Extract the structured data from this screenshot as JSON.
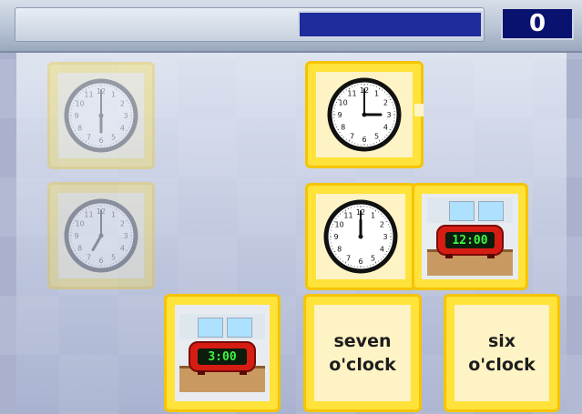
{
  "score": {
    "value": "0"
  },
  "progress": {
    "fraction": 1.0
  },
  "board": {
    "clock_cards": [
      {
        "id": "clock-3",
        "hour_hand_deg": 90,
        "minute_hand_deg": 0,
        "faded": false
      },
      {
        "id": "clock-12",
        "hour_hand_deg": 0,
        "minute_hand_deg": 0,
        "faded": false
      },
      {
        "id": "ghost-6",
        "hour_hand_deg": 180,
        "minute_hand_deg": 0,
        "faded": true
      },
      {
        "id": "ghost-7",
        "hour_hand_deg": 210,
        "minute_hand_deg": 0,
        "faded": true
      }
    ],
    "alarm_cards": [
      {
        "time": "12:00"
      },
      {
        "time": "3:00"
      }
    ],
    "word_cards": [
      {
        "text_line1": "seven",
        "text_line2": "o'clock"
      },
      {
        "text_line1": "six",
        "text_line2": "o'clock"
      }
    ]
  },
  "colors": {
    "card_yellow": "#ffe23a",
    "score_bg": "#0a1270",
    "alarm_red": "#d61d13",
    "digit_green": "#3cf542"
  }
}
